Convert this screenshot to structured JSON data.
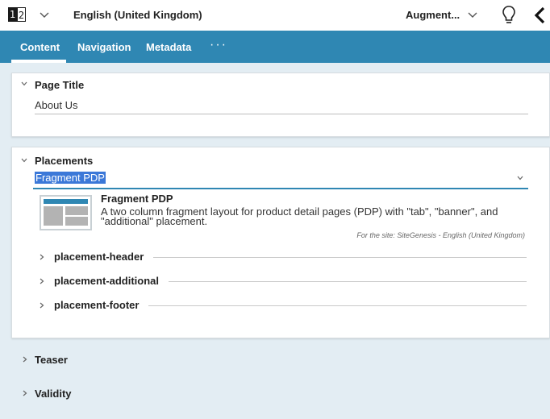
{
  "topbar": {
    "lang_digits": [
      "1",
      "2"
    ],
    "language": "English (United Kingdom)",
    "augment": "Augment..."
  },
  "tabs": [
    {
      "label": "Content"
    },
    {
      "label": "Navigation"
    },
    {
      "label": "Metadata"
    }
  ],
  "tabs_more": "···",
  "page_title_panel": {
    "title": "Page Title",
    "value": "About Us"
  },
  "placements_panel": {
    "title": "Placements",
    "selected": "Fragment PDP",
    "fragment": {
      "title": "Fragment PDP",
      "description": "A two column fragment layout for product detail pages (PDP) with \"tab\", \"banner\", and \"additional\" placement.",
      "site": "For the site: SiteGenesis - English (United Kingdom)"
    },
    "placements": [
      {
        "label": "placement-header"
      },
      {
        "label": "placement-additional"
      },
      {
        "label": "placement-footer"
      }
    ]
  },
  "collapsed_sections": [
    {
      "label": "Teaser"
    },
    {
      "label": "Validity"
    }
  ],
  "colors": {
    "accent": "#2f87b3",
    "selection": "#3b78d8",
    "background": "#e3edf3"
  }
}
